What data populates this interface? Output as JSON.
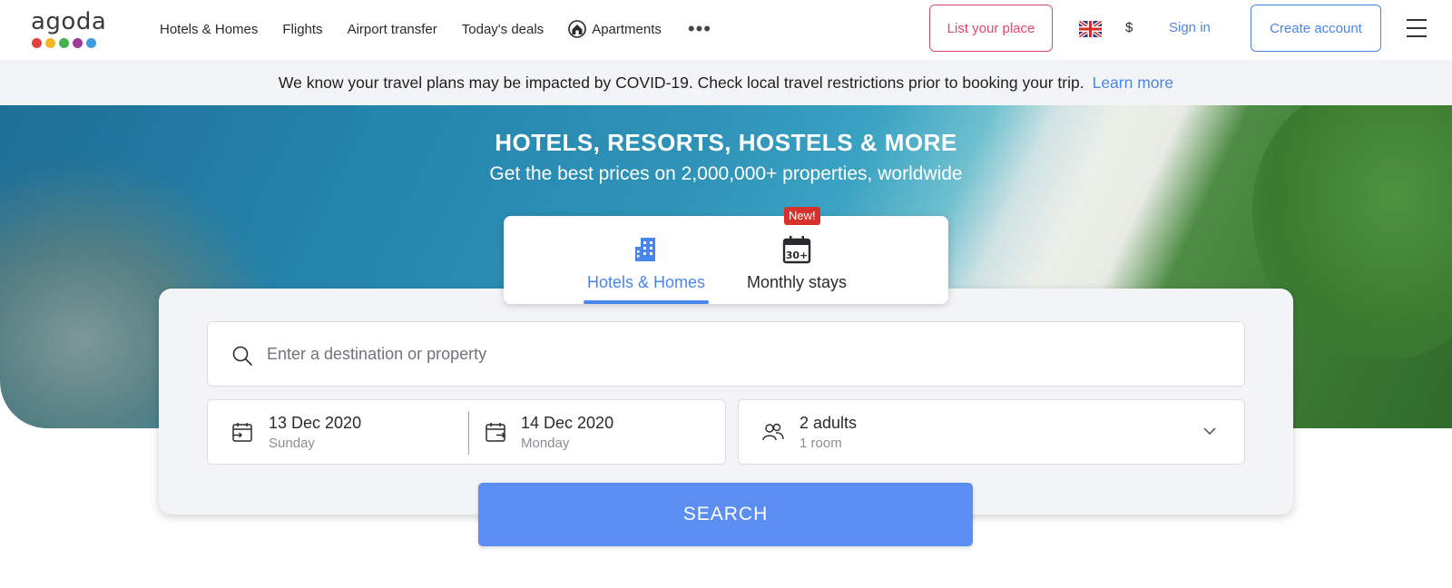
{
  "logo": {
    "text": "agoda",
    "dot_colors": [
      "#e1423c",
      "#f6b42b",
      "#46b04a",
      "#9b3c9a",
      "#3c9ee0"
    ]
  },
  "nav": {
    "items": [
      "Hotels & Homes",
      "Flights",
      "Airport transfer",
      "Today's deals"
    ],
    "apartments_label": "Apartments",
    "more_glyph": "•••"
  },
  "header": {
    "list_place": "List your place",
    "currency": "$",
    "sign_in": "Sign in",
    "create_account": "Create account"
  },
  "banner": {
    "message": "We know your travel plans may be impacted by COVID-19. Check local travel restrictions prior to booking your trip.",
    "link": "Learn more"
  },
  "hero": {
    "title": "HOTELS, RESORTS, HOSTELS & MORE",
    "subtitle": "Get the best prices on 2,000,000+ properties, worldwide"
  },
  "tabs": {
    "hotels_label": "Hotels & Homes",
    "monthly_label": "Monthly stays",
    "monthly_icon_text": "30+",
    "new_badge": "New!",
    "active": "Hotels & Homes"
  },
  "search": {
    "placeholder": "Enter a destination or property",
    "check_in_date": "13 Dec 2020",
    "check_in_day": "Sunday",
    "check_out_date": "14 Dec 2020",
    "check_out_day": "Monday",
    "guests": "2 adults",
    "rooms": "1 room",
    "button": "SEARCH"
  },
  "colors": {
    "accent_blue": "#4a86e8",
    "search_button": "#5b8ef0",
    "list_place_pink": "#e2466f",
    "new_badge_red": "#d8312c",
    "banner_bg": "#f3f4f6"
  },
  "icons": [
    "building-icon",
    "calendar-30-icon",
    "search-icon",
    "calendar-checkin-icon",
    "calendar-checkout-icon",
    "people-icon",
    "chevron-down-icon",
    "apartments-icon",
    "uk-flag-icon",
    "hamburger-menu-icon"
  ]
}
